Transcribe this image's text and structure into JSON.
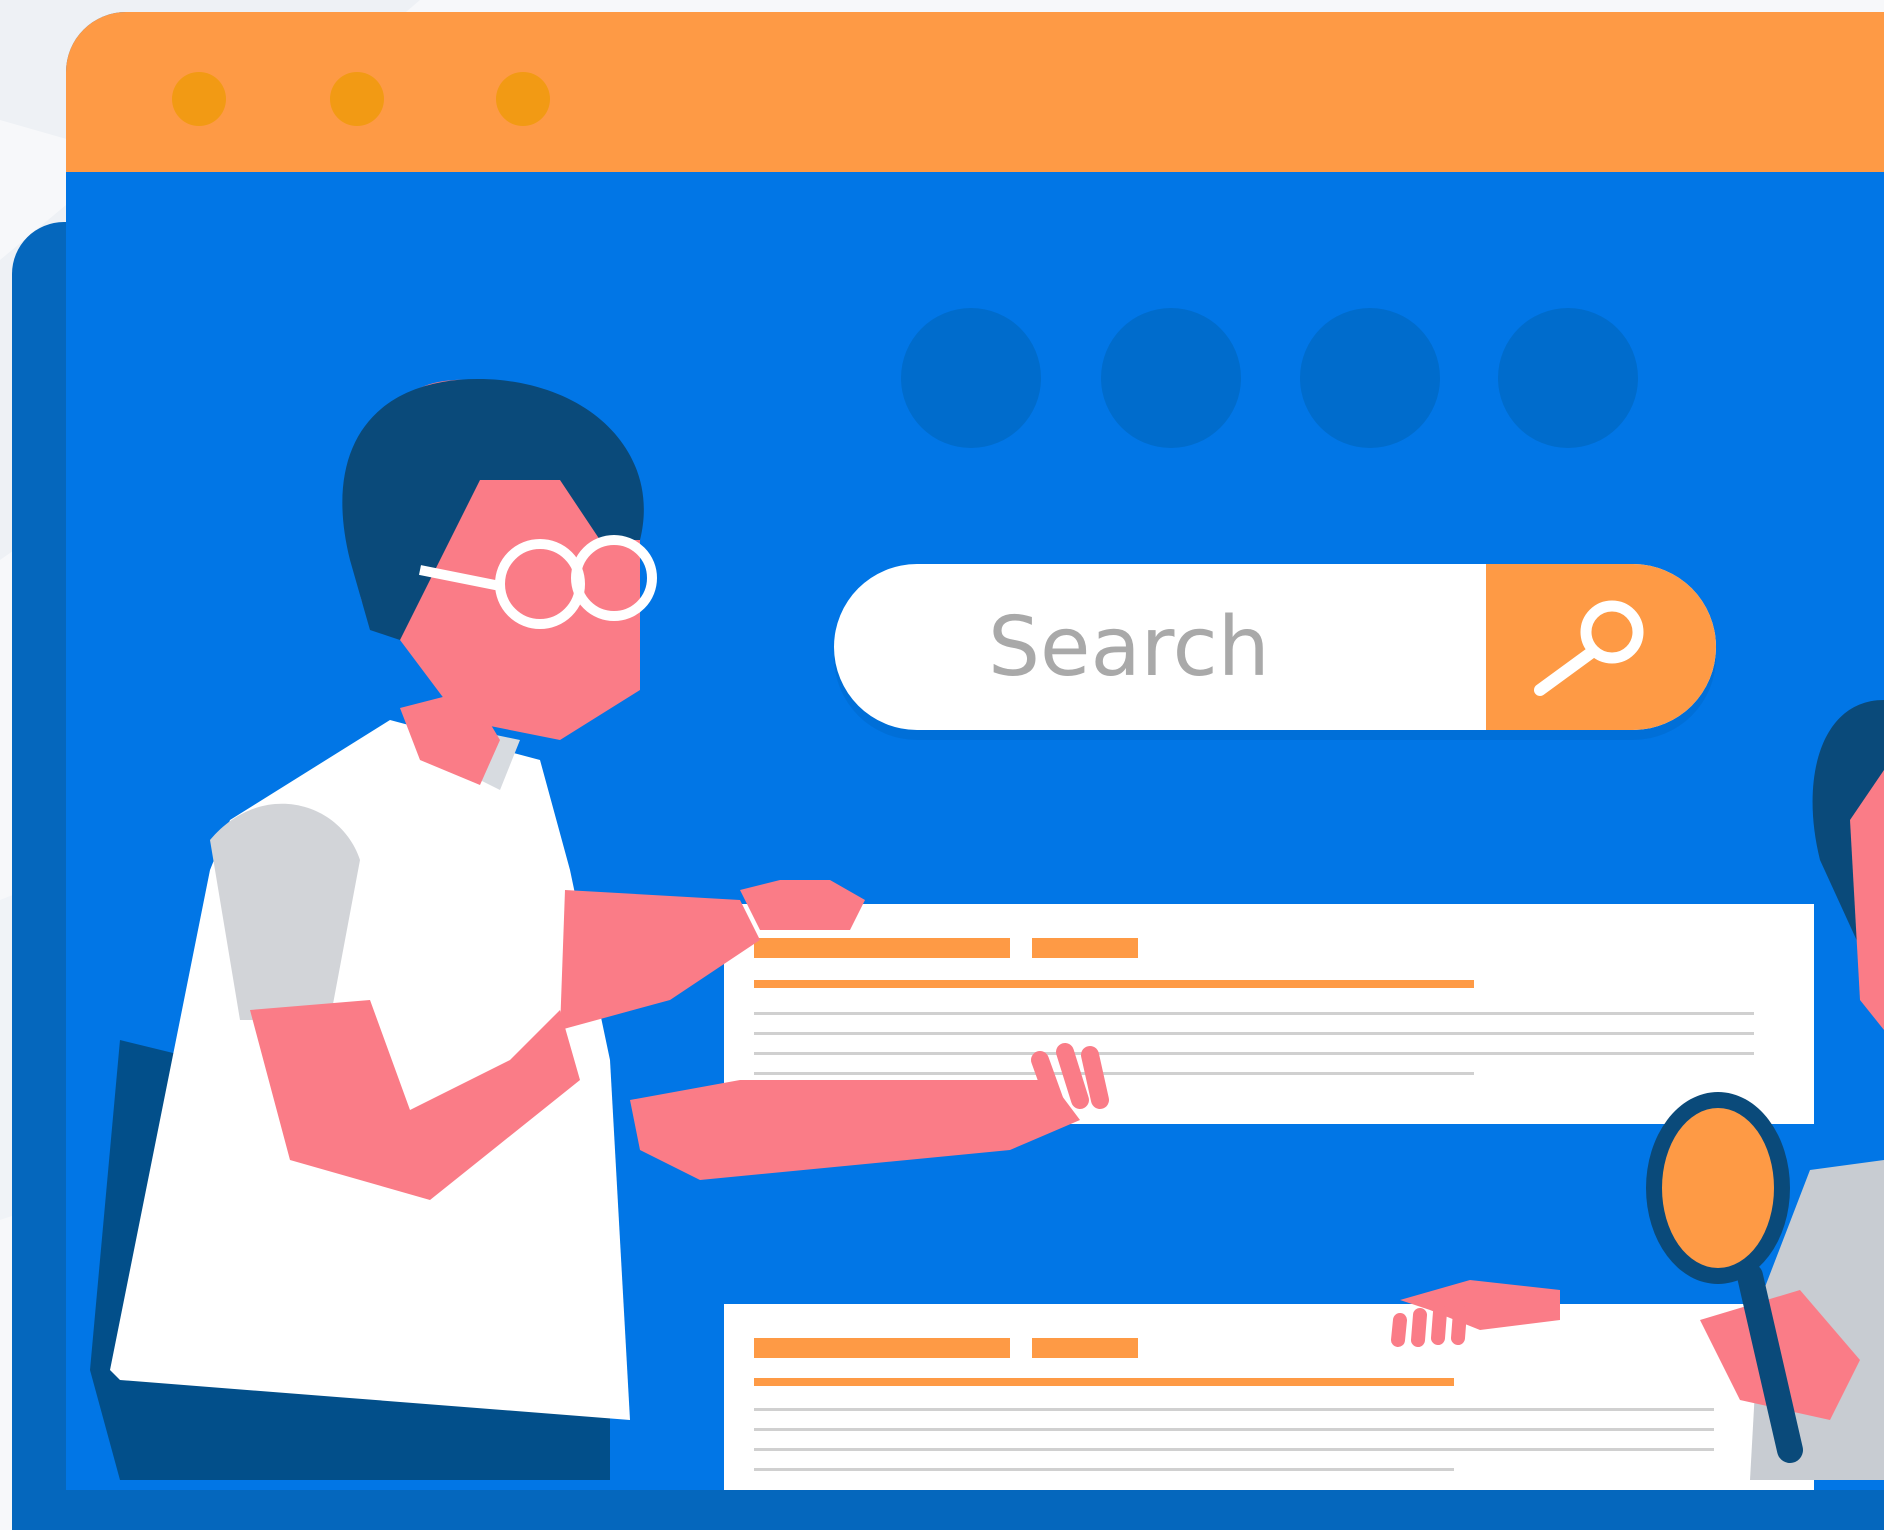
{
  "search": {
    "placeholder": "Search"
  },
  "colors": {
    "window_primary": "#0176e6",
    "window_shadow": "#0567bd",
    "titlebar": "#fe9a45",
    "window_button": "#f29a14",
    "nav_dot": "#006ccc",
    "accent": "#fe9a45",
    "skin": "#fa7c87",
    "hair": "#0a4a7a"
  },
  "icons": {
    "search_button": "magnifier-icon"
  }
}
